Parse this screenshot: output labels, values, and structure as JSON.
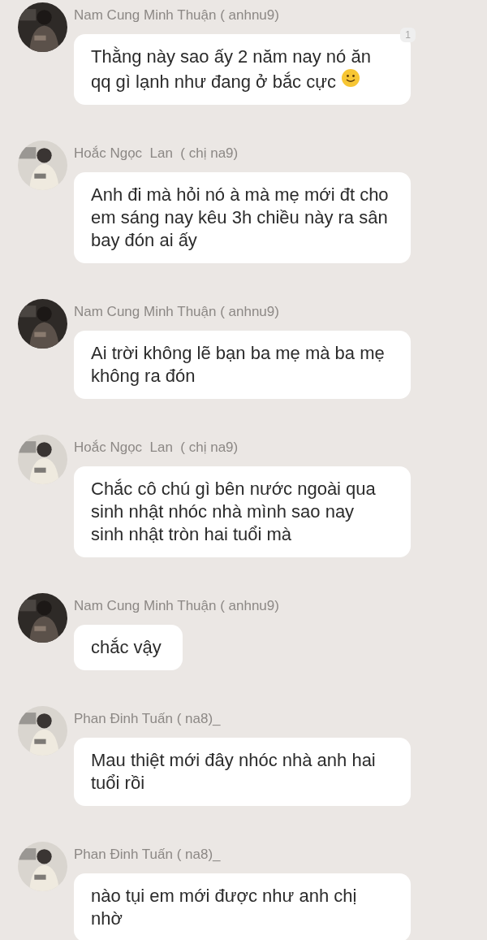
{
  "messages": [
    {
      "sender": "Nam Cung Minh Thuận ( anhnu9)",
      "text": "Thằng này sao ấy 2 năm nay nó ăn qq gì lạnh như đang ở bắc cực",
      "smiley": true,
      "badge": "1"
    },
    {
      "sender": "Hoắc Ngọc  Lan  ( chị na9)",
      "text": "Anh đi mà hỏi nó à mà mẹ mới đt cho em sáng nay kêu 3h chiều này ra sân bay đón ai ấy"
    },
    {
      "sender": "Nam Cung Minh Thuận ( anhnu9)",
      "text": "Ai trời không lẽ bạn ba mẹ mà ba mẹ không ra đón"
    },
    {
      "sender": "Hoắc Ngọc  Lan  ( chị na9)",
      "text": "Chắc cô chú gì bên nước ngoài qua sinh nhật nhóc nhà mình sao nay sinh nhật tròn hai tuổi mà"
    },
    {
      "sender": "Nam Cung Minh Thuận ( anhnu9)",
      "text": "chắc vậy"
    },
    {
      "sender": "Phan Đinh Tuấn ( na8)_",
      "text": "Mau thiệt mới đây nhóc nhà anh hai tuổi rồi"
    },
    {
      "sender": "Phan Đinh Tuấn ( na8)_",
      "text": "nào tụi em mới được như anh chị nhờ"
    }
  ]
}
